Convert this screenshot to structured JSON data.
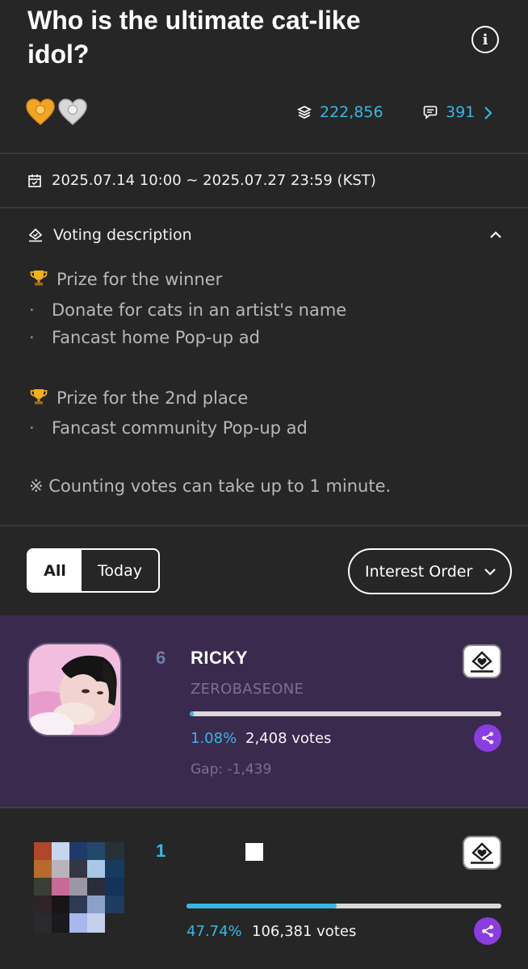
{
  "poll": {
    "title": "Who is the ultimate cat-like idol?",
    "total_votes": "222,856",
    "comments": "391",
    "period": "2025.07.14 10:00 ~ 2025.07.27 23:59 (KST)"
  },
  "description": {
    "header": "Voting description",
    "prize1_title": "Prize for the winner",
    "prize1_items": [
      "Donate for cats in an artist's name",
      "Fancast home Pop-up ad"
    ],
    "prize2_title": "Prize for the 2nd place",
    "prize2_items": [
      "Fancast community Pop-up ad"
    ],
    "note": "※ Counting votes can take up to 1 minute."
  },
  "filters": {
    "tab_all": "All",
    "tab_today": "Today",
    "sort_label": "Interest Order"
  },
  "my_candidate": {
    "rank": "6",
    "name": "RICKY",
    "group": "ZEROBASEONE",
    "percent": "1.08%",
    "percent_value": 1.08,
    "votes": "2,408 votes",
    "gap": "Gap: -1,439"
  },
  "leader": {
    "rank": "1",
    "name": "",
    "percent": "47.74%",
    "percent_value": 47.74,
    "votes": "106,381 votes"
  },
  "colors": {
    "accent": "#35b8e6",
    "highlight_bg": "#3a2a4e",
    "share": "#8a3de0",
    "background": "#262626"
  },
  "icons": [
    "info-icon",
    "gold-heart-icon",
    "silver-heart-icon",
    "votes-stack-icon",
    "comment-icon",
    "chevron-right-icon",
    "calendar-icon",
    "ballot-icon",
    "chevron-up-icon",
    "trophy-icon",
    "chevron-down-icon",
    "vote-icon",
    "share-icon"
  ]
}
